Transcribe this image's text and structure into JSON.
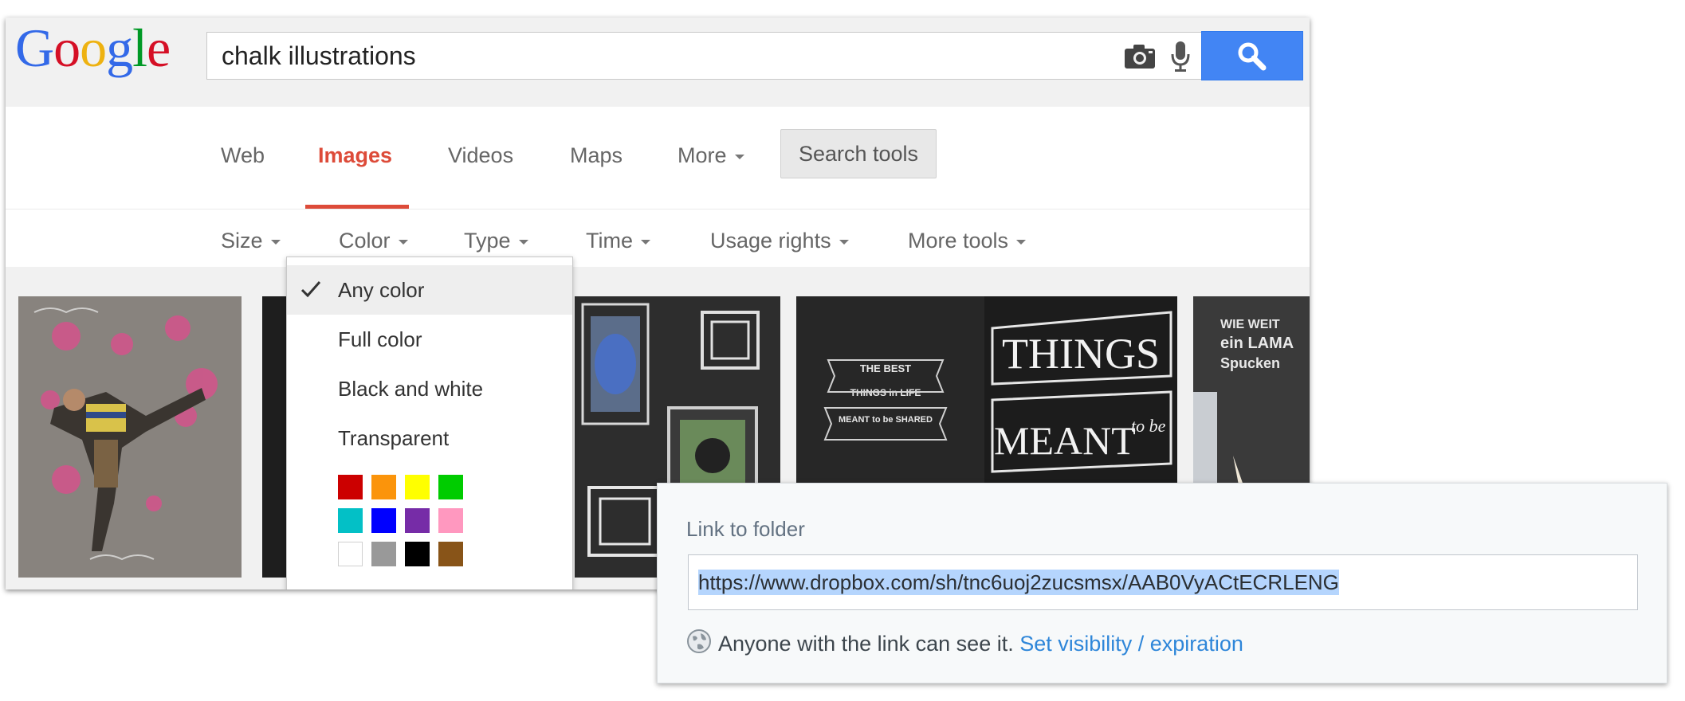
{
  "google": {
    "logo": [
      "G",
      "o",
      "o",
      "g",
      "l",
      "e"
    ],
    "logo_colors": [
      "#3369e8",
      "#d50f25",
      "#eeb211",
      "#3369e8",
      "#009925",
      "#d50f25"
    ],
    "search": {
      "value": "chalk illustrations"
    },
    "icons": {
      "camera": "camera-icon",
      "mic": "microphone-icon",
      "search": "magnifier-icon"
    },
    "tabs": [
      {
        "label": "Web",
        "active": false
      },
      {
        "label": "Images",
        "active": true
      },
      {
        "label": "Videos",
        "active": false
      },
      {
        "label": "Maps",
        "active": false
      },
      {
        "label": "More",
        "active": false
      }
    ],
    "search_tools_label": "Search tools",
    "tools": [
      "Size",
      "Color",
      "Type",
      "Time",
      "Usage rights",
      "More tools"
    ],
    "color_menu": {
      "options": [
        {
          "label": "Any color",
          "selected": true
        },
        {
          "label": "Full color",
          "selected": false
        },
        {
          "label": "Black and white",
          "selected": false
        },
        {
          "label": "Transparent",
          "selected": false
        }
      ],
      "swatches": [
        "#cc0000",
        "#fb940b",
        "#ffff00",
        "#00cc00",
        "#03c0c6",
        "#0000ff",
        "#762ca7",
        "#ff98bf",
        "#ffffff",
        "#999999",
        "#000000",
        "#885418"
      ]
    },
    "thumbnails": {
      "things_text": "THINGS",
      "meant_text": "MEANT",
      "to_be_text": "to be",
      "the_best_text": "THE BEST",
      "things_in_life_text": "THINGS in LIFE",
      "meant_to_be_shared_text": "MEANT to be SHARED",
      "lama_lines": [
        "WIE WEIT",
        "ein LAMA",
        "Spucken"
      ]
    }
  },
  "dropbox": {
    "title": "Link to folder",
    "url": "https://www.dropbox.com/sh/tnc6uoj2zucsmsx/AAB0VyACtECRLENG",
    "visibility_text": "Anyone with the link can see it.",
    "visibility_link": "Set visibility / expiration"
  }
}
